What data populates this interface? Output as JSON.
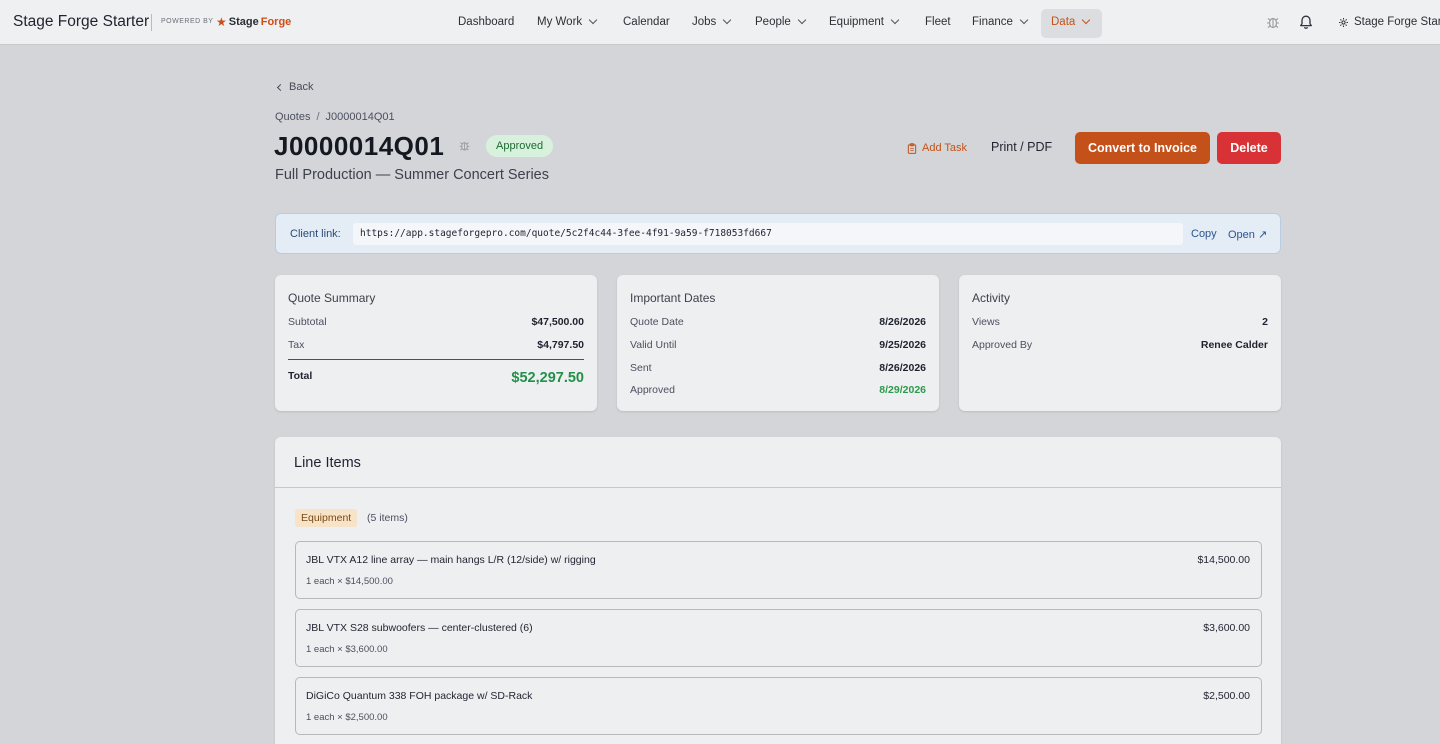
{
  "app": {
    "title": "Stage Forge Starter",
    "powered_by": "POWERED BY",
    "logo_part1": "Stage",
    "logo_part2": "Forge",
    "account": "Stage Forge Starter"
  },
  "nav": [
    {
      "label": "Dashboard"
    },
    {
      "label": "My Work"
    },
    {
      "label": "Calendar"
    },
    {
      "label": "Jobs"
    },
    {
      "label": "People"
    },
    {
      "label": "Equipment"
    },
    {
      "label": "Fleet"
    },
    {
      "label": "Finance"
    },
    {
      "label": "Data"
    }
  ],
  "page": {
    "back": "Back",
    "crumb_root": "Quotes",
    "crumb_sep": "/",
    "crumb_current": "J0000014Q01",
    "quote_id": "J0000014Q01",
    "status": "Approved",
    "subtitle": "Full Production — Summer Concert Series"
  },
  "actions": {
    "add_task": "Add Task",
    "print": "Print / PDF",
    "convert": "Convert to Invoice",
    "delete": "Delete"
  },
  "client_link": {
    "label": "Client link:",
    "url": "https://app.stageforgepro.com/quote/5c2f4c44-3fee-4f91-9a59-f718053fd667",
    "copy": "Copy",
    "open": "Open ↗"
  },
  "summary": {
    "title": "Quote Summary",
    "subtotal_label": "Subtotal",
    "subtotal": "$47,500.00",
    "tax_label": "Tax",
    "tax": "$4,797.50",
    "total_label": "Total",
    "total": "$52,297.50"
  },
  "dates": {
    "title": "Important Dates",
    "quote_date_label": "Quote Date",
    "quote_date": "8/26/2026",
    "valid_until_label": "Valid Until",
    "valid_until": "9/25/2026",
    "sent_label": "Sent",
    "sent": "8/26/2026",
    "approved_label": "Approved",
    "approved": "8/29/2026"
  },
  "activity": {
    "title": "Activity",
    "views_label": "Views",
    "views": "2",
    "approved_by_label": "Approved By",
    "approved_by": "Renee Calder"
  },
  "line_items": {
    "title": "Line Items",
    "category": "Equipment",
    "category_count": "(5 items)",
    "items": [
      {
        "name": "JBL VTX A12 line array — main hangs L/R (12/side) w/ rigging",
        "detail": "1 each × $14,500.00",
        "price": "$14,500.00"
      },
      {
        "name": "JBL VTX S28 subwoofers — center-clustered (6)",
        "detail": "1 each × $3,600.00",
        "price": "$3,600.00"
      },
      {
        "name": "DiGiCo Quantum 338 FOH package w/ SD-Rack",
        "detail": "1 each × $2,500.00",
        "price": "$2,500.00"
      }
    ]
  },
  "colors": {
    "accent": "#c4501a",
    "danger": "#d93236",
    "success": "#23904a"
  }
}
